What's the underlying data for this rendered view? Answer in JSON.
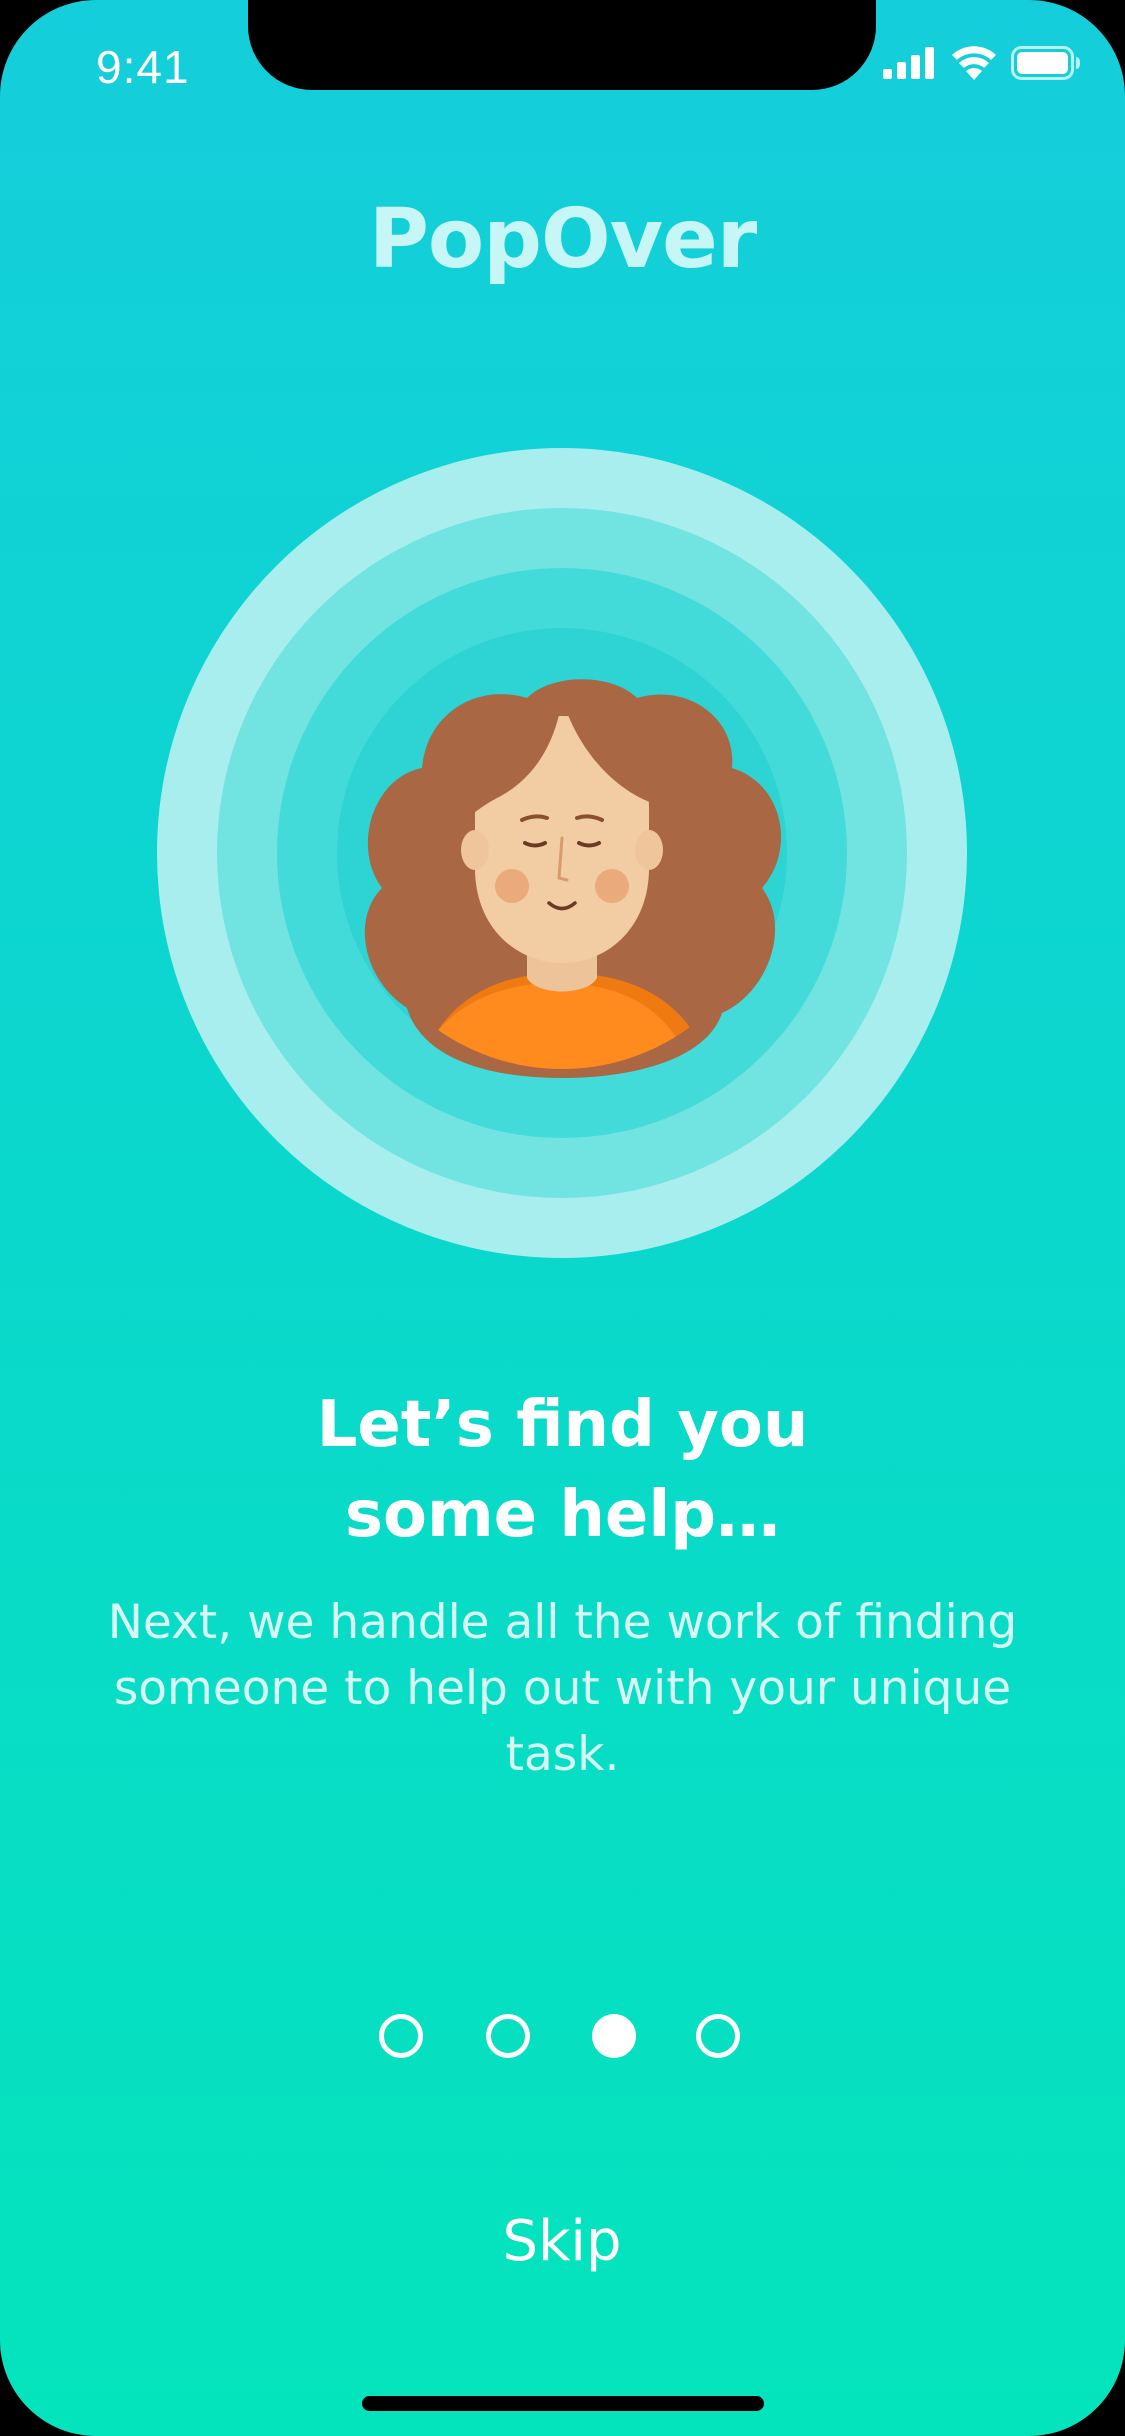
{
  "status_bar": {
    "time": "9:41",
    "icons": [
      "cellular-signal-icon",
      "wifi-icon",
      "battery-icon"
    ]
  },
  "app": {
    "title": "PopOver"
  },
  "onboarding": {
    "headline_line1": "Let’s find you",
    "headline_line2": "some help…",
    "body": "Next, we handle all the work of finding someone to help out with your unique task.",
    "pagination": {
      "total_pages": 4,
      "current_page": 3
    },
    "skip_label": "Skip"
  },
  "colors": {
    "background_top": "#15cedb",
    "background_bottom": "#04e4bc",
    "title": "#c6f6f6",
    "text": "#ffffff",
    "ring_outer": "#a8eeee",
    "ring_2": "#71e4e1",
    "ring_3": "#43dada",
    "ring_inner": "#2ed3d4",
    "hair": "#a96744",
    "skin": "#f2cda3",
    "shirt": "#ff8a1e"
  }
}
